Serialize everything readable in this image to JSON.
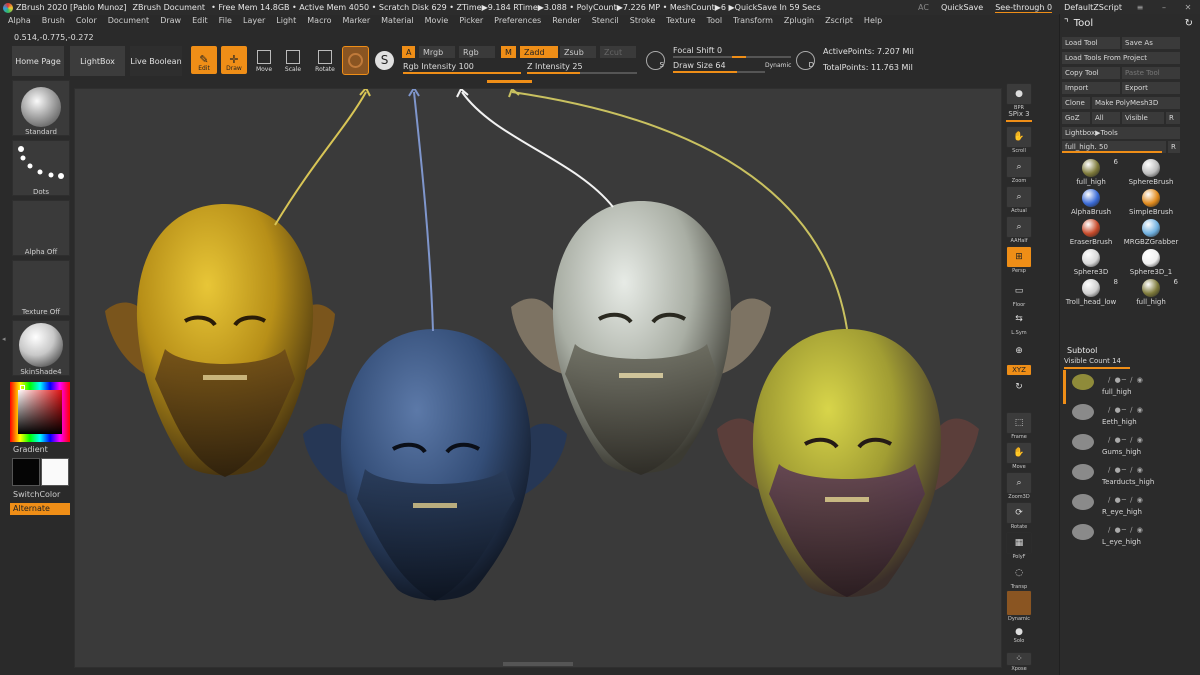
{
  "titlebar": {
    "app": "ZBrush 2020 [Pablo Munoz]",
    "document": "ZBrush Document",
    "stats": "• Free Mem 14.8GB • Active Mem 4050 • Scratch Disk 629 • ZTime▶9.184 RTime▶3.088 • PolyCount▶7.226 MP • MeshCount▶6 ▶QuickSave In 59 Secs",
    "ac": "AC",
    "quicksave": "QuickSave",
    "seethrough": "See-through 0",
    "script": "DefaultZScript"
  },
  "menu": [
    "Alpha",
    "Brush",
    "Color",
    "Document",
    "Draw",
    "Edit",
    "File",
    "Layer",
    "Light",
    "Macro",
    "Marker",
    "Material",
    "Movie",
    "Picker",
    "Preferences",
    "Render",
    "Stencil",
    "Stroke",
    "Texture",
    "Tool",
    "Transform",
    "Zplugin",
    "Zscript",
    "Help"
  ],
  "coords": "0.514,-0.775,-0.272",
  "shelf": {
    "home": "Home Page",
    "lightbox": "LightBox",
    "liveboolean": "Live Boolean",
    "edit": "Edit",
    "draw": "Draw",
    "move": "Move",
    "scale": "Scale",
    "rotate": "Rotate",
    "a": "A",
    "mrgb": "Mrgb",
    "rgb": "Rgb",
    "m": "M",
    "zadd": "Zadd",
    "zsub": "Zsub",
    "zcut": "Zcut",
    "rgb_intensity": "Rgb Intensity 100",
    "z_intensity": "Z Intensity 25",
    "focal": "Focal Shift 0",
    "drawsize": "Draw Size 64",
    "dynamic": "Dynamic",
    "active_points": "ActivePoints: 7.207 Mil",
    "total_points": "TotalPoints: 11.763 Mil",
    "s_label": "S",
    "d_label": "D"
  },
  "left": {
    "standard": "Standard",
    "dots": "Dots",
    "alpha_off": "Alpha Off",
    "texture_off": "Texture Off",
    "skinshade": "SkinShade4",
    "gradient": "Gradient",
    "switchcolor": "SwitchColor",
    "alternate": "Alternate"
  },
  "right": {
    "bpr": "BPR",
    "spix": "SPix 3",
    "scroll": "Scroll",
    "zoom": "Zoom",
    "actual": "Actual",
    "aahalf": "AAHalf",
    "persp": "Persp",
    "floor": "Floor",
    "lsym": "L.Sym",
    "xyz": "XYZ",
    "frame": "Frame",
    "move": "Move",
    "zoom3d": "Zoom3D",
    "rotate": "Rotate",
    "polyf": "PolyF",
    "transp": "Transp",
    "dynamic": "Dynamic",
    "solo": "Solo",
    "xpose": "Xpose"
  },
  "tool": {
    "title": "Tool",
    "load": "Load Tool",
    "saveas": "Save As",
    "loadfromproject": "Load Tools From Project",
    "copy": "Copy Tool",
    "paste": "Paste Tool",
    "import": "Import",
    "export": "Export",
    "clone": "Clone",
    "makepoly": "Make PolyMesh3D",
    "goz": "GoZ",
    "all": "All",
    "visible": "Visible",
    "r": "R",
    "lightboxtools": "Lightbox▶Tools",
    "fullhigh_slider": "full_high. 50",
    "r2": "R",
    "thumbs": [
      {
        "label": "full_high",
        "count": "6",
        "color": "#7e7a3a"
      },
      {
        "label": "SphereBrush",
        "count": "",
        "color": "#bdbdbd"
      },
      {
        "label": "AlphaBrush",
        "count": "",
        "color": "#3a6bd8"
      },
      {
        "label": "SimpleBrush",
        "count": "",
        "color": "#e08a1c"
      },
      {
        "label": "EraserBrush",
        "count": "",
        "color": "#c74a2a"
      },
      {
        "label": "MRGBZGrabber",
        "count": "",
        "color": "#6fb0e0"
      },
      {
        "label": "Sphere3D",
        "count": "",
        "color": "#d8d8d8"
      },
      {
        "label": "Sphere3D_1",
        "count": "",
        "color": "#efefef"
      },
      {
        "label": "Troll_head_low",
        "count": "8",
        "color": "#cfcfcf"
      },
      {
        "label": "full_high",
        "count": "6",
        "color": "#7e7a3a"
      }
    ],
    "subtool": "Subtool",
    "visiblecount": "Visible Count 14",
    "subtools": [
      "full_high",
      "Eeth_high",
      "Gums_high",
      "Tearducts_high",
      "R_eye_high",
      "L_eye_high"
    ]
  },
  "colors": {
    "accent": "#ef8e17",
    "head_yellow": "#c9a01d",
    "head_blue": "#3a5680",
    "head_white": "#c7cbc3",
    "head_lime": "#b9b63a",
    "arrow_yellow": "#d8c556",
    "arrow_blue": "#7f96cc",
    "arrow_white": "#f2f2f2",
    "arrow_olive": "#c9c160"
  }
}
